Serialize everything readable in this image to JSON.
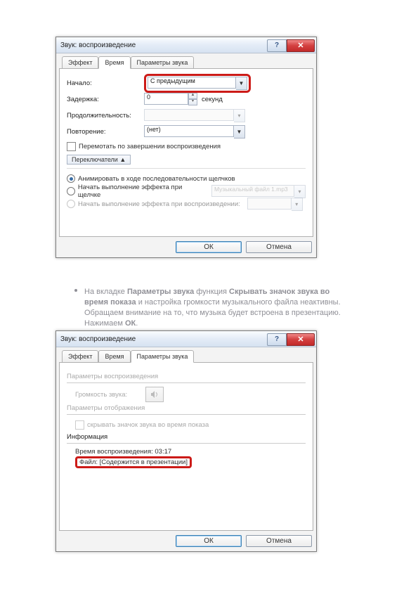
{
  "dialog1": {
    "title": "Звук: воспроизведение",
    "help": "?",
    "close": "✕",
    "tabs": {
      "effect": "Эффект",
      "time": "Время",
      "params": "Параметры звука"
    },
    "rows": {
      "start_lbl": "Начало:",
      "start_val": "С предыдущим",
      "delay_lbl": "Задержка:",
      "delay_val": "0",
      "delay_unit": "секунд",
      "duration_lbl": "Продолжительность:",
      "repeat_lbl": "Повторение:",
      "repeat_val": "(нет)",
      "rewind_cb": "Перемотать по завершении воспроизведения",
      "toggles_btn": "Переключатели ▲",
      "radio1": "Анимировать в ходе последовательности щелчков",
      "radio2": "Начать выполнение эффекта при щелчке",
      "radio2_val": "Музыкальный файл 1.mp3",
      "radio3": "Начать выполнение эффекта при воспроизведении:"
    },
    "buttons": {
      "ok": "ОК",
      "cancel": "Отмена"
    }
  },
  "mid": {
    "p1a": "На вкладке ",
    "p1b": "Параметры звука",
    "p1c": " функция ",
    "p1d": "Скрывать значок звука во время показа",
    "p1e": " и настройка громкости музыкального файла неактивны. Обращаем внимание на то, что музыка будет встроена в презентацию. Нажимаем ",
    "p1f": "ОК",
    "p1g": "."
  },
  "dialog2": {
    "title": "Звук: воспроизведение",
    "tabs": {
      "effect": "Эффект",
      "time": "Время",
      "params": "Параметры звука"
    },
    "playback_group": "Параметры воспроизведения",
    "volume_lbl": "Громкость звука:",
    "display_group": "Параметры отображения",
    "hide_cb": "скрывать значок звука во время показа",
    "info_group": "Информация",
    "play_len_lbl": "Время воспроизведения: ",
    "play_len_val": "03:17",
    "file_lbl": "Файл: ",
    "file_val": "[Содержится в презентации]",
    "buttons": {
      "ok": "ОК",
      "cancel": "Отмена"
    }
  }
}
